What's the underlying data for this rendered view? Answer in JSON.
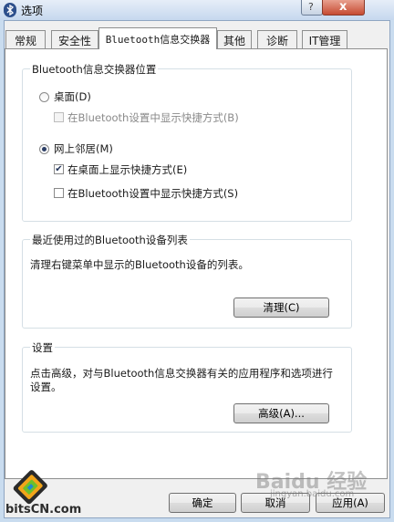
{
  "window": {
    "title": "选项",
    "help_glyph": "?",
    "close_glyph": "x"
  },
  "tabs": [
    {
      "label": "常规"
    },
    {
      "label": "安全性"
    },
    {
      "label": "Bluetooth信息交换器"
    },
    {
      "label": "其他"
    },
    {
      "label": "诊断"
    },
    {
      "label": "IT管理"
    }
  ],
  "location_group": {
    "title": "Bluetooth信息交换器位置",
    "desktop_radio": "桌面(D)",
    "desktop_show_shortcut": "在Bluetooth设置中显示快捷方式(B)",
    "network_radio": "网上邻居(M)",
    "network_show_desktop": "在桌面上显示快捷方式(E)",
    "network_show_bt": "在Bluetooth设置中显示快捷方式(S)"
  },
  "recent_group": {
    "title": "最近使用过的Bluetooth设备列表",
    "description": "清理右键菜单中显示的Bluetooth设备的列表。",
    "clear_button": "清理(C)"
  },
  "settings_group": {
    "title": "设置",
    "description_line1": "点击高级，对与Bluetooth信息交换器有关的应用程序和选项进行",
    "description_line2": "设置。",
    "advanced_button": "高级(A)..."
  },
  "footer": {
    "ok": "确定",
    "cancel": "取消",
    "apply": "应用(A)"
  },
  "branding": {
    "site_logo_text": "bitsCN.com",
    "watermark": "Baidu 经验",
    "watermark_sub": "jingyan.baidu.com"
  },
  "state": {
    "selected_location": "网上邻居(M)",
    "desktop_show_shortcut_checked": false,
    "network_show_desktop_checked": true,
    "network_show_bt_checked": false
  }
}
